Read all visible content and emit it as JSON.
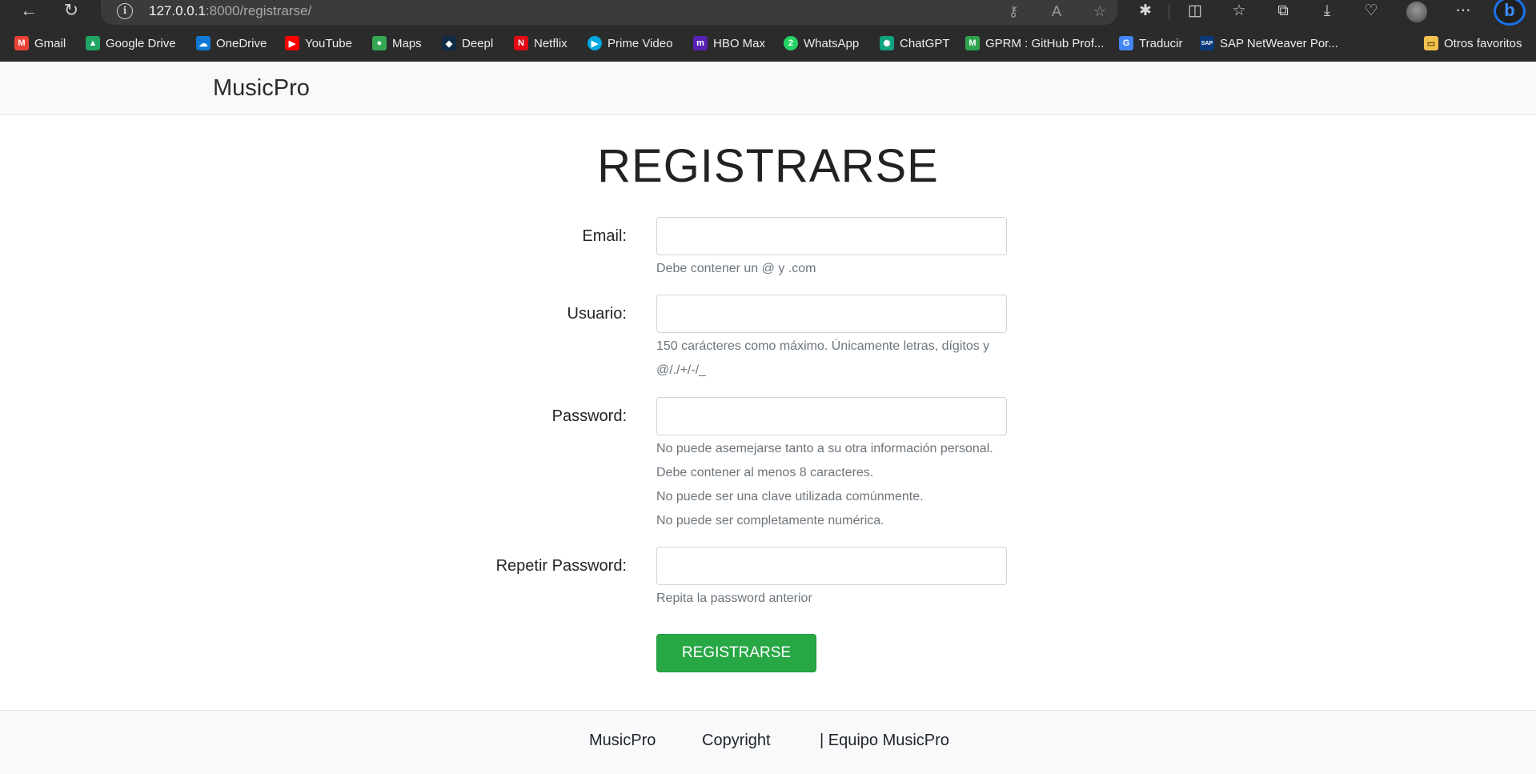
{
  "browser": {
    "url_host": "127.0.0.1",
    "url_rest": ":8000/registrarse/",
    "bookmarks": [
      {
        "label": "Gmail",
        "icon": "gmail-icon",
        "color": "#ea4335",
        "glyph": "M"
      },
      {
        "label": "Google Drive",
        "icon": "google-drive-icon",
        "color": "#1fa463",
        "glyph": "▲"
      },
      {
        "label": "OneDrive",
        "icon": "onedrive-icon",
        "color": "#0f78d4",
        "glyph": "☁"
      },
      {
        "label": "YouTube",
        "icon": "youtube-icon",
        "color": "#ff0000",
        "glyph": "▶"
      },
      {
        "label": "Maps",
        "icon": "maps-icon",
        "color": "#34a853",
        "glyph": "●"
      },
      {
        "label": "Deepl",
        "icon": "deepl-icon",
        "color": "#0f2b46",
        "glyph": "◆"
      },
      {
        "label": "Netflix",
        "icon": "netflix-icon",
        "color": "#e50914",
        "glyph": "N"
      },
      {
        "label": "Prime Video",
        "icon": "prime-video-icon",
        "color": "#00a8e1",
        "glyph": "▶"
      },
      {
        "label": "HBO Max",
        "icon": "hbo-max-icon",
        "color": "#5822b4",
        "glyph": "m"
      },
      {
        "label": "WhatsApp",
        "icon": "whatsapp-icon",
        "color": "#25d366",
        "glyph": "2"
      },
      {
        "label": "ChatGPT",
        "icon": "chatgpt-icon",
        "color": "#10a37f",
        "glyph": "✺"
      },
      {
        "label": "GPRM : GitHub Prof...",
        "icon": "github-profile-icon",
        "color": "#2ea44f",
        "glyph": "M"
      },
      {
        "label": "Traducir",
        "icon": "translate-icon",
        "color": "#4285f4",
        "glyph": "G"
      },
      {
        "label": "SAP NetWeaver Por...",
        "icon": "sap-icon",
        "color": "#0a3a7a",
        "glyph": "SAP"
      }
    ],
    "other_favorites": "Otros favoritos"
  },
  "navbar": {
    "brand": "MusicPro"
  },
  "form": {
    "title": "REGISTRARSE",
    "email_label": "Email:",
    "email_help": "Debe contener un @ y .com",
    "username_label": "Usuario:",
    "username_help_1": "150 carácteres como máximo. Únicamente letras, dígitos y",
    "username_help_2": "@/./+/-/_",
    "password_label": "Password:",
    "password_help": [
      "No puede asemejarse tanto a su otra información personal.",
      "Debe contener al menos 8 caracteres.",
      "No puede ser una clave utilizada comúnmente.",
      "No puede ser completamente numérica."
    ],
    "password2_label": "Repetir Password:",
    "password2_help": "Repita la password anterior",
    "submit_label": "REGISTRARSE",
    "submit_color": "#28a745"
  },
  "footer": {
    "brand": "MusicPro",
    "copyright": "Copyright",
    "team": "| Equipo MusicPro"
  }
}
